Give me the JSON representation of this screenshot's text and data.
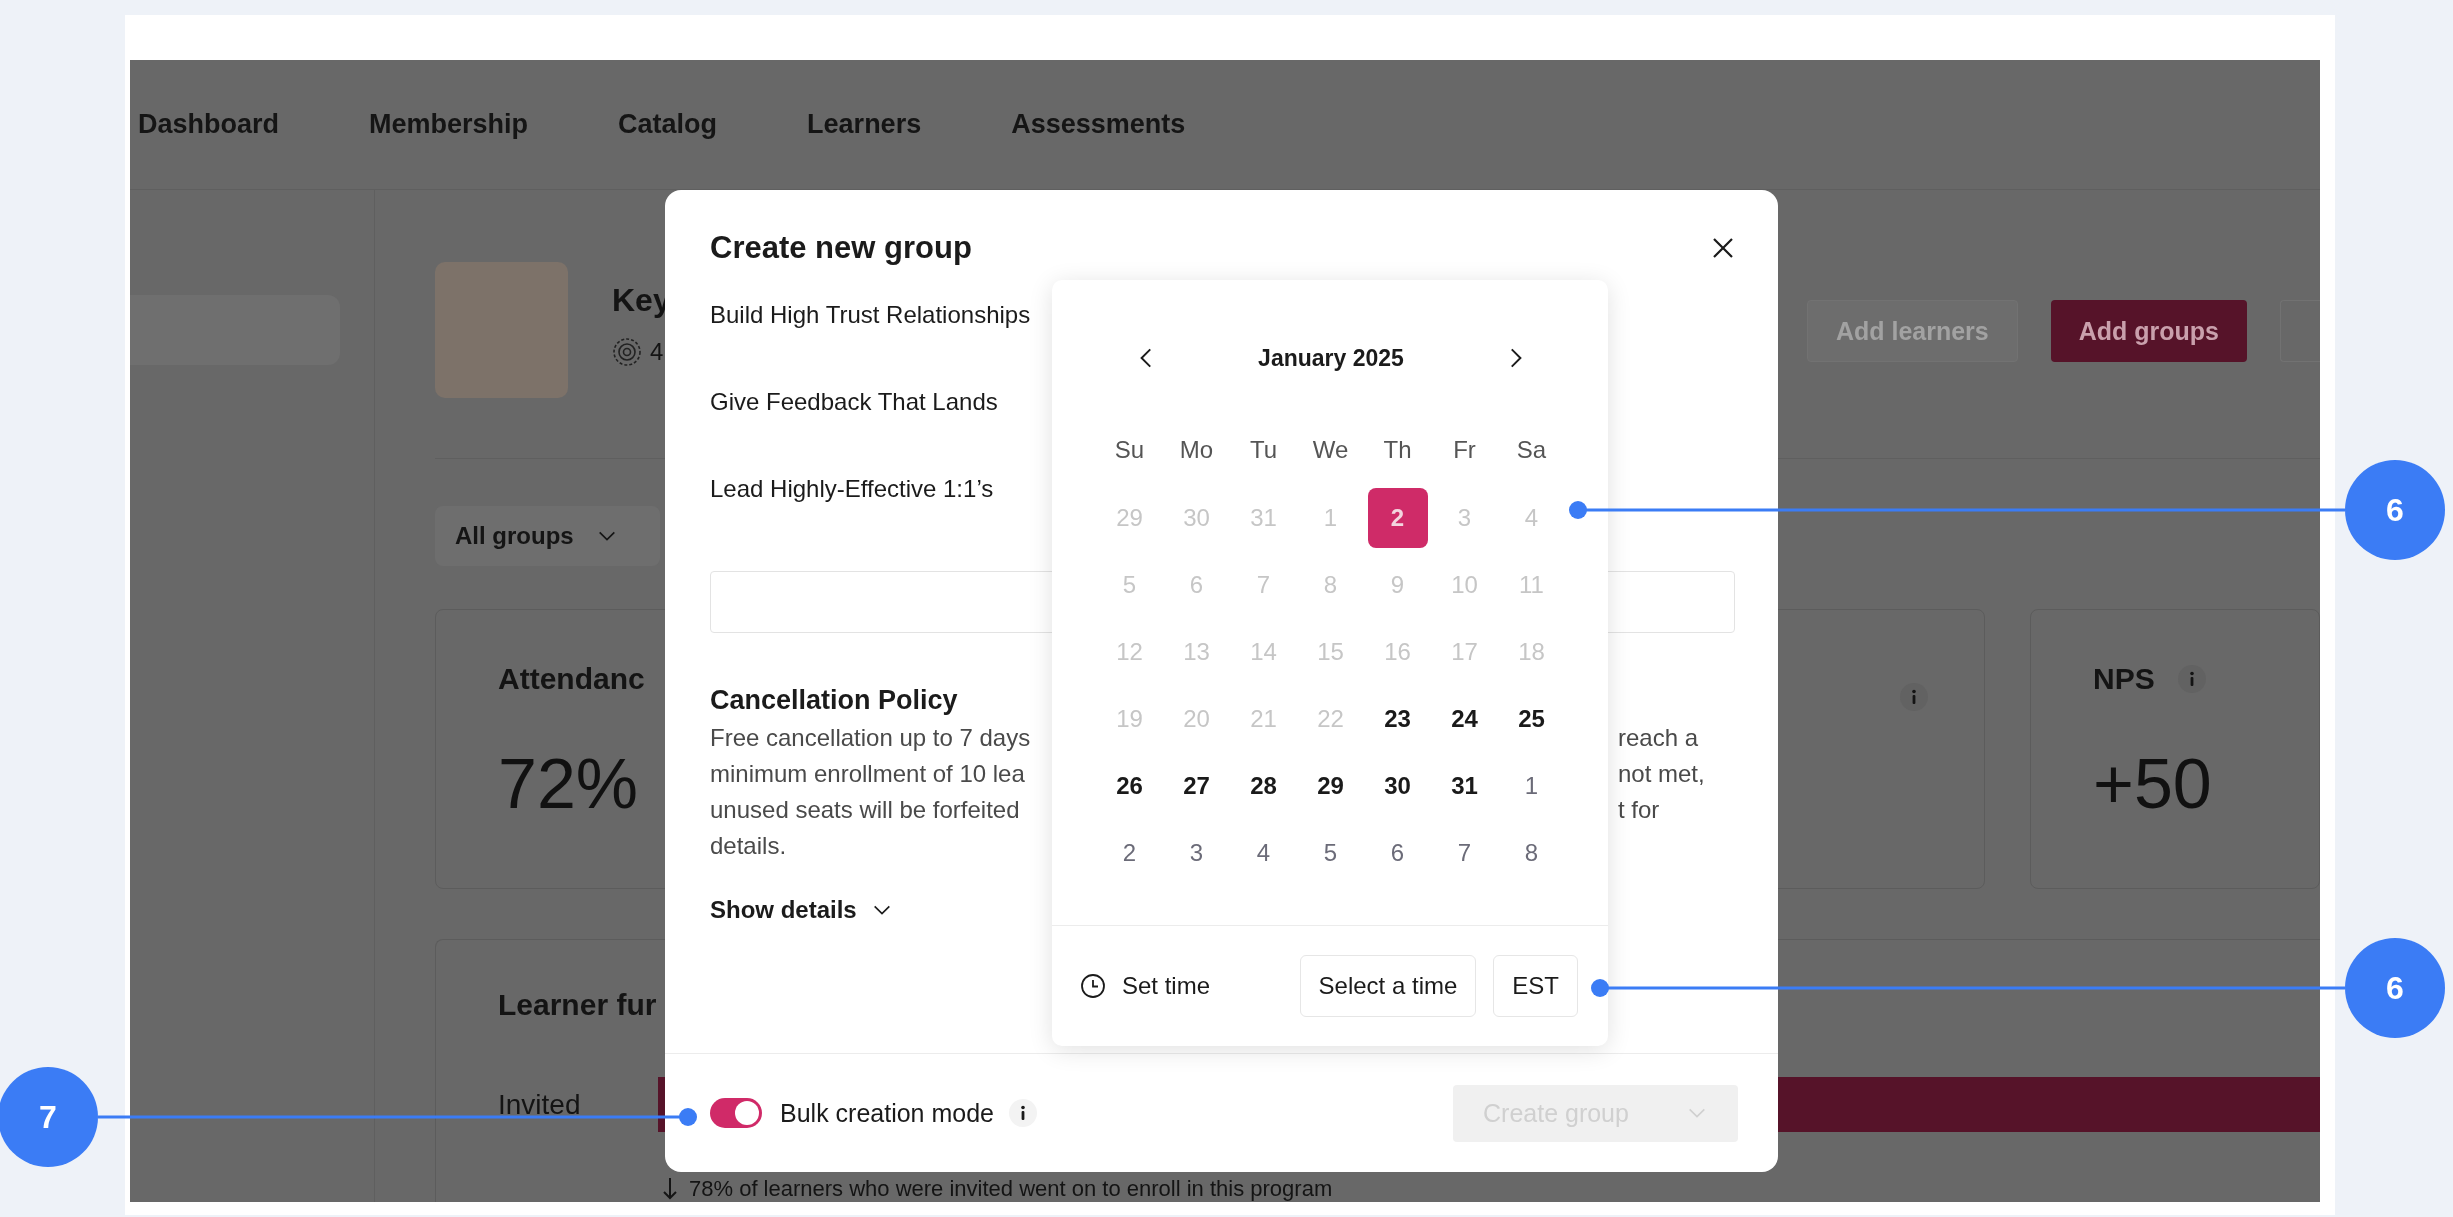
{
  "nav": {
    "items": [
      "Dashboard",
      "Membership",
      "Catalog",
      "Learners",
      "Assessments"
    ]
  },
  "program": {
    "title": "Key",
    "meta": "4"
  },
  "header_buttons": [
    {
      "label": "Add learners",
      "kind": "secondary",
      "disabled": true
    },
    {
      "label": "Add groups",
      "kind": "primary",
      "disabled": false
    }
  ],
  "filter": {
    "label": "All groups"
  },
  "stat_cards": [
    {
      "title": "Attendanc",
      "value": "72%",
      "info": false
    },
    {
      "info": true
    },
    {
      "title": "NPS",
      "value": "+50",
      "info": true
    }
  ],
  "funnel": {
    "title": "Learner fur",
    "rows": [
      {
        "label": "Invited"
      }
    ],
    "note": "78% of learners who were invited went on to enroll in this program"
  },
  "modal": {
    "title": "Create new group",
    "courses": [
      "Build High Trust Relationships",
      "Give Feedback That Lands",
      "Lead Highly-Effective 1:1’s"
    ],
    "policy": {
      "title": "Cancellation Policy",
      "lines_left": [
        "Free cancellation up to 7 days",
        "minimum enrollment of 10 lea",
        "unused seats will be forfeited",
        "details."
      ],
      "lines_right": [
        "reach a",
        "not met,",
        "t for"
      ]
    },
    "show_details": "Show details",
    "bulk_mode": {
      "label": "Bulk creation mode",
      "on": true
    },
    "submit": {
      "label": "Create group",
      "disabled": true
    }
  },
  "calendar": {
    "month": "January 2025",
    "weekdays": [
      "Su",
      "Mo",
      "Tu",
      "We",
      "Th",
      "Fr",
      "Sa"
    ],
    "weeks": [
      [
        {
          "day": "29",
          "kind": "muted",
          "selected": false
        },
        {
          "day": "30",
          "kind": "muted",
          "selected": false
        },
        {
          "day": "31",
          "kind": "muted",
          "selected": false
        },
        {
          "day": "1",
          "kind": "muted",
          "selected": false
        },
        {
          "day": "2",
          "kind": "muted",
          "selected": true
        },
        {
          "day": "3",
          "kind": "muted",
          "selected": false
        },
        {
          "day": "4",
          "kind": "muted",
          "selected": false
        }
      ],
      [
        {
          "day": "5",
          "kind": "muted",
          "selected": false
        },
        {
          "day": "6",
          "kind": "muted",
          "selected": false
        },
        {
          "day": "7",
          "kind": "muted",
          "selected": false
        },
        {
          "day": "8",
          "kind": "muted",
          "selected": false
        },
        {
          "day": "9",
          "kind": "muted",
          "selected": false
        },
        {
          "day": "10",
          "kind": "muted",
          "selected": false
        },
        {
          "day": "11",
          "kind": "muted",
          "selected": false
        }
      ],
      [
        {
          "day": "12",
          "kind": "muted",
          "selected": false
        },
        {
          "day": "13",
          "kind": "muted",
          "selected": false
        },
        {
          "day": "14",
          "kind": "muted",
          "selected": false
        },
        {
          "day": "15",
          "kind": "muted",
          "selected": false
        },
        {
          "day": "16",
          "kind": "muted",
          "selected": false
        },
        {
          "day": "17",
          "kind": "muted",
          "selected": false
        },
        {
          "day": "18",
          "kind": "muted",
          "selected": false
        }
      ],
      [
        {
          "day": "19",
          "kind": "muted",
          "selected": false
        },
        {
          "day": "20",
          "kind": "muted",
          "selected": false
        },
        {
          "day": "21",
          "kind": "muted",
          "selected": false
        },
        {
          "day": "22",
          "kind": "muted",
          "selected": false
        },
        {
          "day": "23",
          "kind": "available",
          "selected": false
        },
        {
          "day": "24",
          "kind": "available",
          "selected": false
        },
        {
          "day": "25",
          "kind": "available",
          "selected": false
        }
      ],
      [
        {
          "day": "26",
          "kind": "available",
          "selected": false
        },
        {
          "day": "27",
          "kind": "available",
          "selected": false
        },
        {
          "day": "28",
          "kind": "available",
          "selected": false
        },
        {
          "day": "29",
          "kind": "available",
          "selected": false
        },
        {
          "day": "30",
          "kind": "available",
          "selected": false
        },
        {
          "day": "31",
          "kind": "available",
          "selected": false
        },
        {
          "day": "1",
          "kind": "next",
          "selected": false
        }
      ],
      [
        {
          "day": "2",
          "kind": "next",
          "selected": false
        },
        {
          "day": "3",
          "kind": "next",
          "selected": false
        },
        {
          "day": "4",
          "kind": "next",
          "selected": false
        },
        {
          "day": "5",
          "kind": "next",
          "selected": false
        },
        {
          "day": "6",
          "kind": "next",
          "selected": false
        },
        {
          "day": "7",
          "kind": "next",
          "selected": false
        },
        {
          "day": "8",
          "kind": "next",
          "selected": false
        }
      ]
    ],
    "time_label": "Set time",
    "time_button": "Select a time",
    "timezone": "EST"
  },
  "annotations": [
    {
      "number": "6"
    },
    {
      "number": "6"
    },
    {
      "number": "7"
    }
  ]
}
